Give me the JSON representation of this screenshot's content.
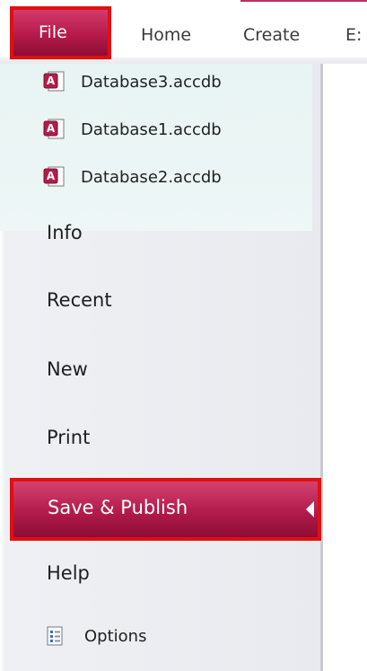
{
  "ribbon": {
    "tabs": [
      "File",
      "Home",
      "Create",
      "E:"
    ]
  },
  "backstage": {
    "recent_files": [
      {
        "name": "Database3.accdb",
        "icon": "access-database-icon"
      },
      {
        "name": "Database1.accdb",
        "icon": "access-database-icon"
      },
      {
        "name": "Database2.accdb",
        "icon": "access-database-icon"
      }
    ],
    "menu": {
      "info": "Info",
      "recent": "Recent",
      "new": "New",
      "print": "Print",
      "save_publish": "Save & Publish",
      "help": "Help",
      "options": "Options"
    }
  },
  "colors": {
    "accent": "#b51a4b",
    "highlight_border": "#e01010"
  }
}
